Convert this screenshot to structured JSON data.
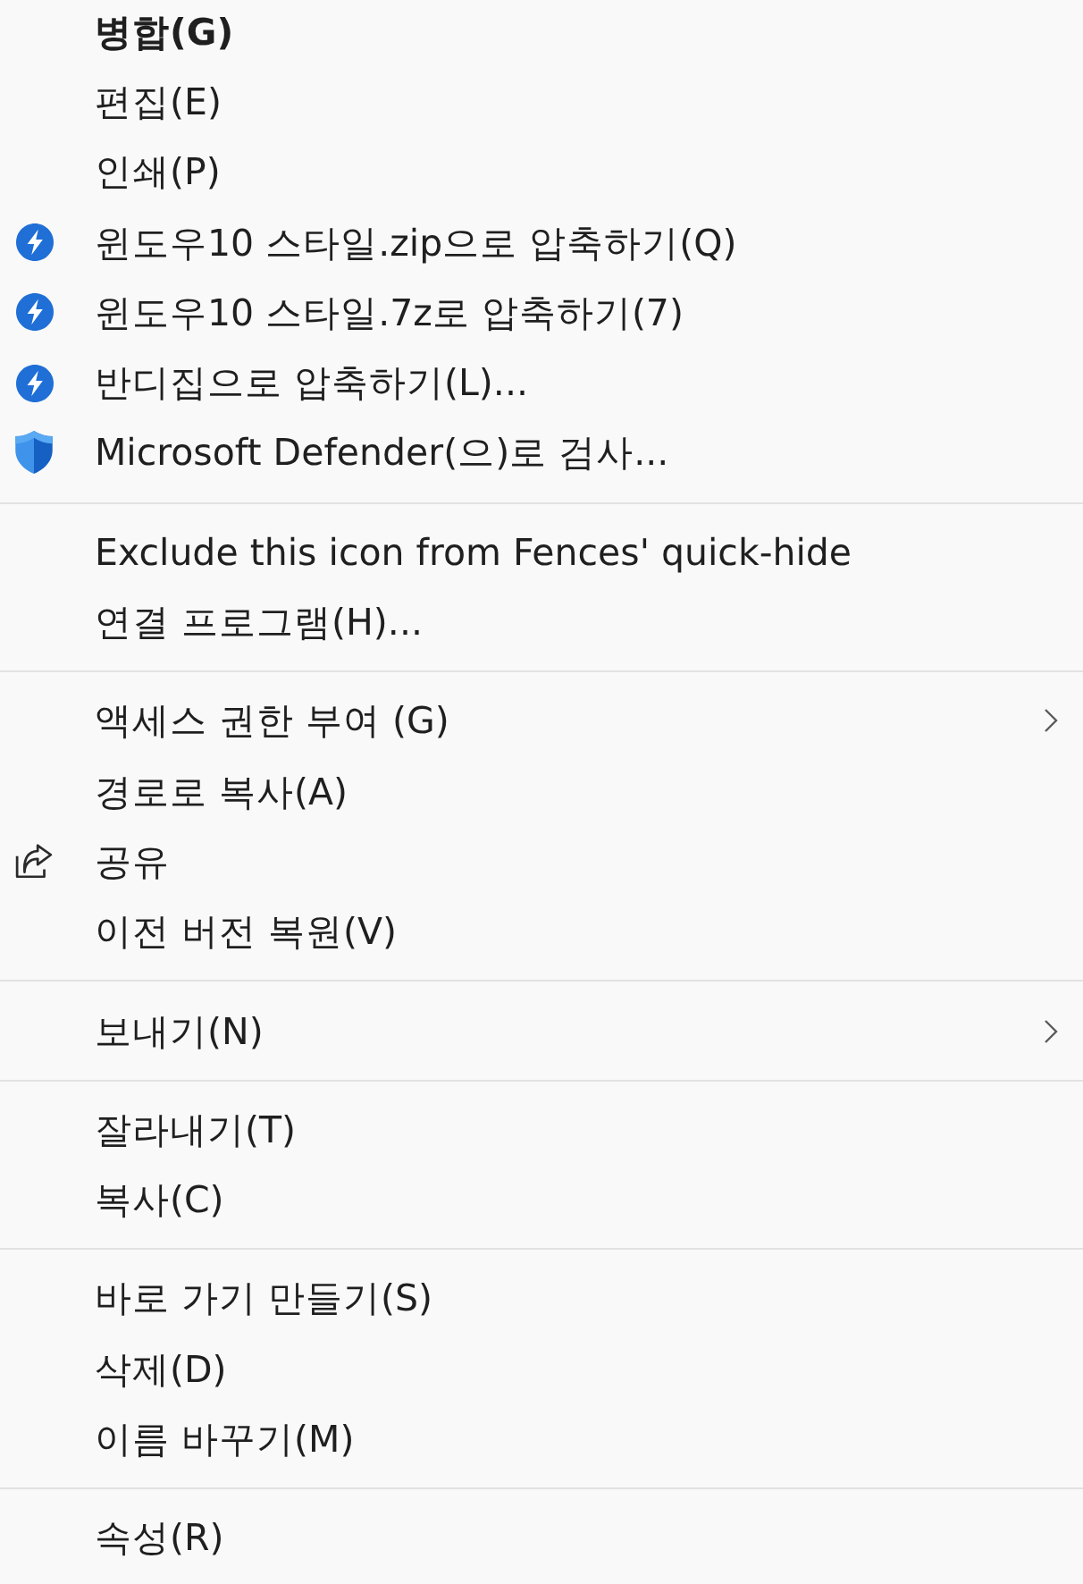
{
  "context_menu": {
    "groups": [
      {
        "items": [
          {
            "label": "병합(G)",
            "kind": "plain",
            "default": true,
            "submenu": false
          },
          {
            "label": "편집(E)",
            "kind": "plain",
            "default": false,
            "submenu": false
          },
          {
            "label": "인쇄(P)",
            "kind": "plain",
            "default": false,
            "submenu": false
          },
          {
            "label": "윈도우10 스타일.zip으로 압축하기(Q)",
            "kind": "archive",
            "default": false,
            "submenu": false
          },
          {
            "label": "윈도우10 스타일.7z로 압축하기(7)",
            "kind": "archive",
            "default": false,
            "submenu": false
          },
          {
            "label": "반디집으로 압축하기(L)...",
            "kind": "archive",
            "default": false,
            "submenu": false
          },
          {
            "label": "Microsoft Defender(으)로 검사...",
            "kind": "scan",
            "default": false,
            "submenu": false
          }
        ]
      },
      {
        "items": [
          {
            "label": "Exclude this icon from Fences' quick-hide",
            "kind": "plain",
            "default": false,
            "submenu": false
          },
          {
            "label": "연결 프로그램(H)...",
            "kind": "plain",
            "default": false,
            "submenu": false
          }
        ]
      },
      {
        "items": [
          {
            "label": "액세스 권한 부여 (G)",
            "kind": "plain",
            "default": false,
            "submenu": true
          },
          {
            "label": "경로로 복사(A)",
            "kind": "plain",
            "default": false,
            "submenu": false
          },
          {
            "label": "공유",
            "kind": "share",
            "default": false,
            "submenu": false
          },
          {
            "label": "이전 버전 복원(V)",
            "kind": "plain",
            "default": false,
            "submenu": false
          }
        ]
      },
      {
        "items": [
          {
            "label": "보내기(N)",
            "kind": "plain",
            "default": false,
            "submenu": true
          }
        ]
      },
      {
        "items": [
          {
            "label": "잘라내기(T)",
            "kind": "plain",
            "default": false,
            "submenu": false
          },
          {
            "label": "복사(C)",
            "kind": "plain",
            "default": false,
            "submenu": false
          }
        ]
      },
      {
        "items": [
          {
            "label": "바로 가기 만들기(S)",
            "kind": "plain",
            "default": false,
            "submenu": false
          },
          {
            "label": "삭제(D)",
            "kind": "plain",
            "default": false,
            "submenu": false
          },
          {
            "label": "이름 바꾸기(M)",
            "kind": "plain",
            "default": false,
            "submenu": false
          }
        ]
      },
      {
        "items": [
          {
            "label": "속성(R)",
            "kind": "plain",
            "default": false,
            "submenu": false
          }
        ]
      }
    ]
  }
}
